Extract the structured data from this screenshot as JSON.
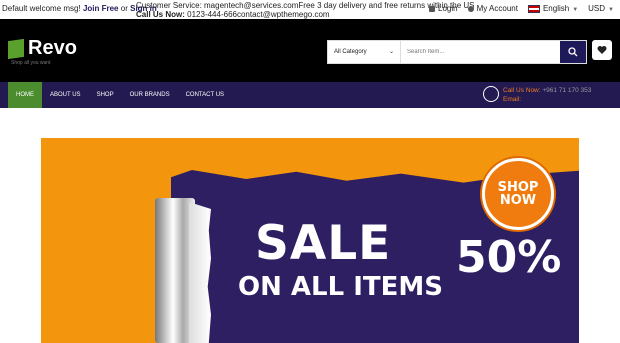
{
  "topbar": {
    "welcome": "Default welcome msg!",
    "join_free": "Join Free",
    "or": "or",
    "sign_in": "Sign in",
    "service_line1": "Customer Service: magentech@services.comFree 3 day delivery and free returns within the US",
    "call_label": "Call Us Now:",
    "call_value": "0123-444-666contact@wpthemego.com",
    "login": "Login",
    "my_account": "My Account",
    "language": "English",
    "currency": "USD"
  },
  "header": {
    "logo_name": "Revo",
    "logo_tagline": "Shop all you want",
    "category_select": "All Category",
    "search_placeholder": "Search Item..."
  },
  "nav": {
    "items": [
      "HOME",
      "ABOUT US",
      "SHOP",
      "OUR BRANDS",
      "CONTACT US"
    ],
    "call_label": "Call Us Now:",
    "call_value": "+961 71 170 353",
    "email_label": "Email:"
  },
  "banner": {
    "sale": "SALE",
    "on_all": "ON ALL ITEMS",
    "percent": "50%",
    "shop": "SHOP",
    "now": "NOW"
  },
  "colors": {
    "brand_purple": "#221a50",
    "accent_green": "#4a8c2e",
    "accent_orange": "#f3960d"
  }
}
